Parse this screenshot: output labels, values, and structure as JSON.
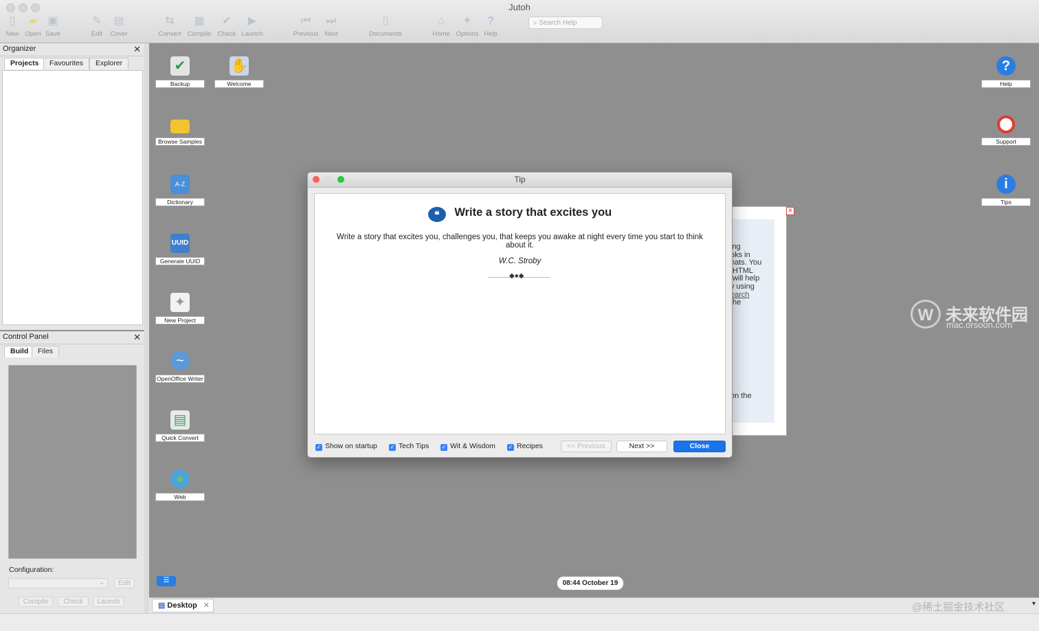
{
  "app": {
    "title": "Jutoh"
  },
  "toolbar": {
    "new": "New",
    "open": "Open",
    "save": "Save",
    "edit": "Edit",
    "cover": "Cover",
    "convert": "Convert",
    "compile": "Compile",
    "check": "Check",
    "launch": "Launch",
    "previous": "Previous",
    "next": "Next",
    "documents": "Documents",
    "home": "Home",
    "options": "Options",
    "help": "Help",
    "search_placeholder": "Search Help"
  },
  "organizer": {
    "title": "Organizer",
    "tabs": [
      "Projects",
      "Favourites",
      "Explorer"
    ]
  },
  "control_panel": {
    "title": "Control Panel",
    "tabs": [
      "Build",
      "Files"
    ],
    "config_label": "Configuration:",
    "edit": "Edit",
    "buttons": [
      "Compile",
      "Check",
      "Launch"
    ]
  },
  "desktop": {
    "icons": {
      "backup": "Backup",
      "welcome": "Welcome",
      "browse_samples": "Browse Samples",
      "dictionary": "Dictionary",
      "generate_uuid": "Generate UUID",
      "new_project": "New Project",
      "openoffice_writer": "OpenOffice Writer",
      "quick_convert": "Quick Convert",
      "web": "Web",
      "help": "Help",
      "support": "Support",
      "tips": "Tips"
    },
    "uuid_glyph": "UUID",
    "status_time": "08:44 October 19",
    "tab_label": "Desktop"
  },
  "back_window": {
    "lines": [
      "ing",
      "oks in",
      "nats. You",
      " HTML",
      " will help",
      "y using",
      "earch",
      "the",
      "on the"
    ]
  },
  "tip_dialog": {
    "title": "Tip",
    "heading": "Write a story that excites you",
    "body": "Write a story that excites you, challenges you, that keeps you awake at night every time you start to think about it.",
    "author": "W.C. Stroby",
    "checkboxes": {
      "show_on_startup": "Show on startup",
      "tech_tips": "Tech Tips",
      "wit_wisdom": "Wit & Wisdom",
      "recipes": "Recipes"
    },
    "prev": "<< Previous",
    "next": "Next >>",
    "close": "Close"
  },
  "watermark": {
    "brand": "未来软件园",
    "url": "mac.orsoon.com",
    "credit": "@稀土掘金技术社区"
  },
  "colors": {
    "accent": "#1a73e8",
    "desktop": "#8f8f8f"
  }
}
